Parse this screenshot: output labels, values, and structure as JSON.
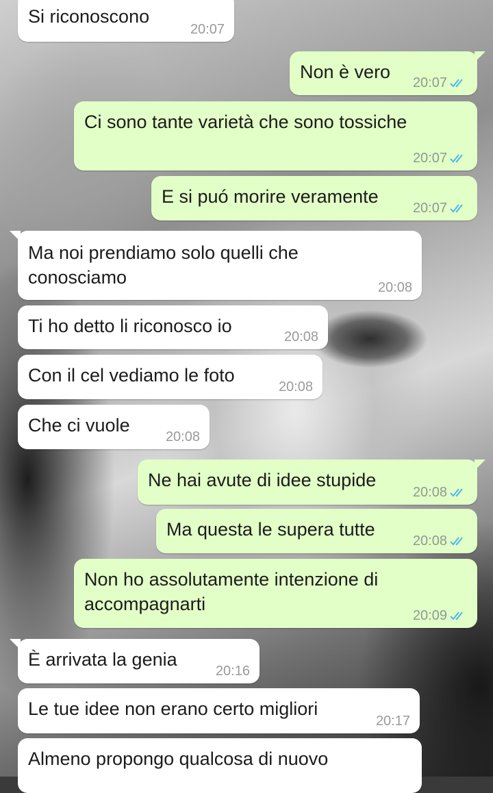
{
  "conversation": {
    "messages": [
      {
        "direction": "in",
        "text": "Si riconoscono",
        "time": "20:07"
      },
      {
        "direction": "out",
        "text": "Non è vero",
        "time": "20:07",
        "status": "read"
      },
      {
        "direction": "out",
        "text": "Ci sono tante varietà che sono tossiche",
        "time": "20:07",
        "status": "read"
      },
      {
        "direction": "out",
        "text": "E si puó morire veramente",
        "time": "20:07",
        "status": "read"
      },
      {
        "direction": "in",
        "text": "Ma noi prendiamo solo quelli che conosciamo",
        "time": "20:08"
      },
      {
        "direction": "in",
        "text": "Ti ho detto li riconosco io",
        "time": "20:08"
      },
      {
        "direction": "in",
        "text": "Con il cel vediamo le foto",
        "time": "20:08"
      },
      {
        "direction": "in",
        "text": "Che ci vuole",
        "time": "20:08"
      },
      {
        "direction": "out",
        "text": "Ne hai avute di idee stupide",
        "time": "20:08",
        "status": "read"
      },
      {
        "direction": "out",
        "text": "Ma questa le supera tutte",
        "time": "20:08",
        "status": "read"
      },
      {
        "direction": "out",
        "text": "Non ho assolutamente intenzione di accompagnarti",
        "time": "20:09",
        "status": "read"
      },
      {
        "direction": "in",
        "text": "È arrivata la genia",
        "time": "20:16"
      },
      {
        "direction": "in",
        "text": "Le tue idee non erano certo migliori",
        "time": "20:17"
      },
      {
        "direction": "in",
        "text": "Almeno propongo qualcosa di nuovo",
        "time": ""
      }
    ]
  },
  "colors": {
    "incoming_bubble": "#ffffff",
    "outgoing_bubble": "#e2ffc7",
    "read_ticks": "#4fb6ec",
    "timestamp": "#8d9a92"
  },
  "icons": {
    "read_status": "double-check-icon"
  }
}
